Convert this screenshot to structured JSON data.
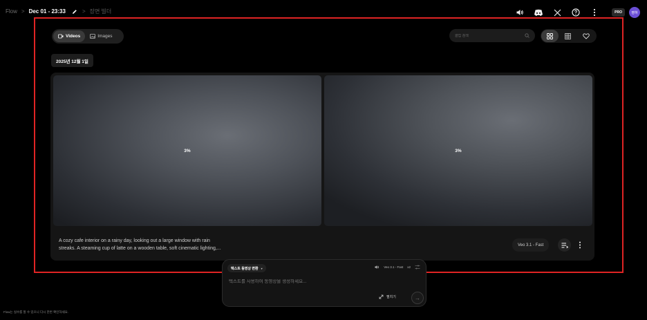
{
  "breadcrumb": {
    "app": "Flow",
    "project_title": "Dec 01 - 23:33",
    "page": "장면 빌더",
    "separator": ">"
  },
  "topbar": {
    "icons": [
      "audio-icon",
      "discord-icon",
      "x-icon",
      "help-icon",
      "more-vert-icon"
    ],
    "pro_badge": "PRO",
    "avatar_text": "영하"
  },
  "filters": {
    "videos_label": "Videos",
    "images_label": "Images",
    "selected": "Videos",
    "search_placeholder": "클립 검색",
    "views": [
      "grid-large-icon",
      "grid-small-icon",
      "heart-icon"
    ],
    "selected_view": "grid-large-icon"
  },
  "date_header": "2025년 12월 1일",
  "card": {
    "thumbnails": [
      {
        "progress": "3%"
      },
      {
        "progress": "3%"
      }
    ],
    "prompt_line1": "A cozy cafe interior on a rainy day, looking out a large window with rain",
    "prompt_line2": "streaks. A steaming cup of latte on a wooden table, soft cinematic lighting,...",
    "model": "Veo 3.1 - Fast"
  },
  "composer": {
    "mode": "텍스트 동영상 변환",
    "model": "Veo 3.1 - Fast",
    "count": "x2",
    "placeholder": "텍스트를 사용하여 동영상을 생성하세요...",
    "expand_label": "펼치기"
  },
  "footer_note": "Flow는 실수를 할 수 있으니 다시 한번 확인하세요.",
  "colors": {
    "background": "#000000",
    "highlight": "#e02424",
    "avatar": "#6b4fd6"
  }
}
